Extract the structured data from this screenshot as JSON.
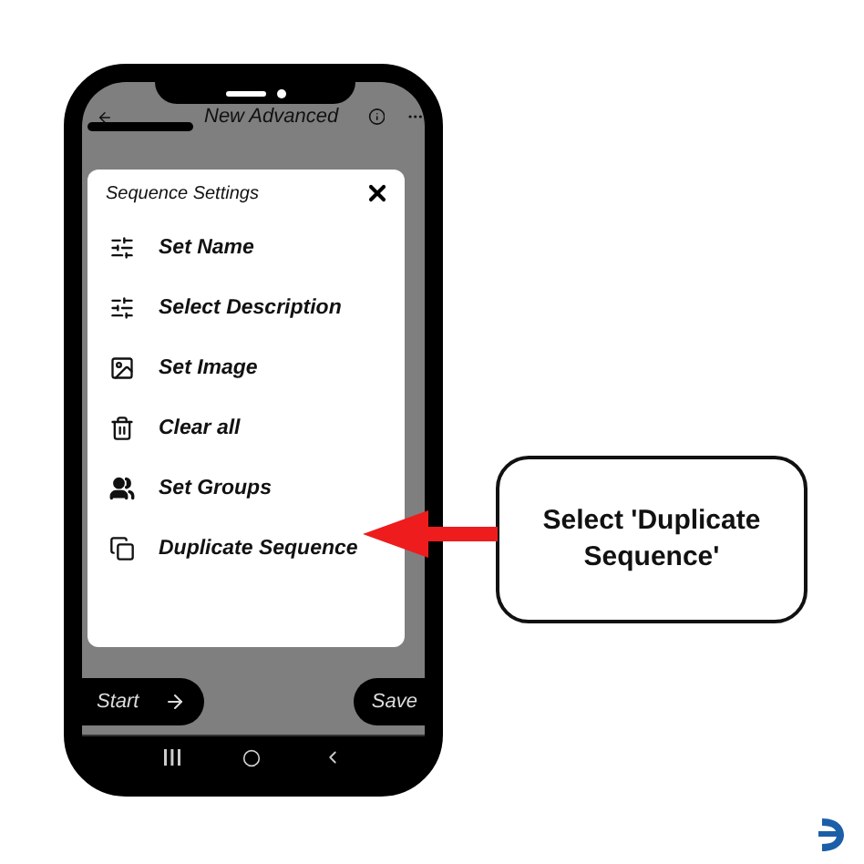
{
  "header": {
    "title": "New Advanced"
  },
  "dialog": {
    "title": "Sequence Settings",
    "items": [
      {
        "label": "Set Name",
        "kind": "sliders"
      },
      {
        "label": "Select Description",
        "kind": "sliders"
      },
      {
        "label": "Set Image",
        "kind": "image"
      },
      {
        "label": "Clear all",
        "kind": "trash"
      },
      {
        "label": "Set Groups",
        "kind": "group"
      },
      {
        "label": "Duplicate Sequence",
        "kind": "copy"
      }
    ]
  },
  "buttons": [
    {
      "label": "Start",
      "kind": "start"
    },
    {
      "label": "Save",
      "kind": "save"
    }
  ],
  "callout": {
    "text": "Select 'Duplicate Sequence'"
  }
}
